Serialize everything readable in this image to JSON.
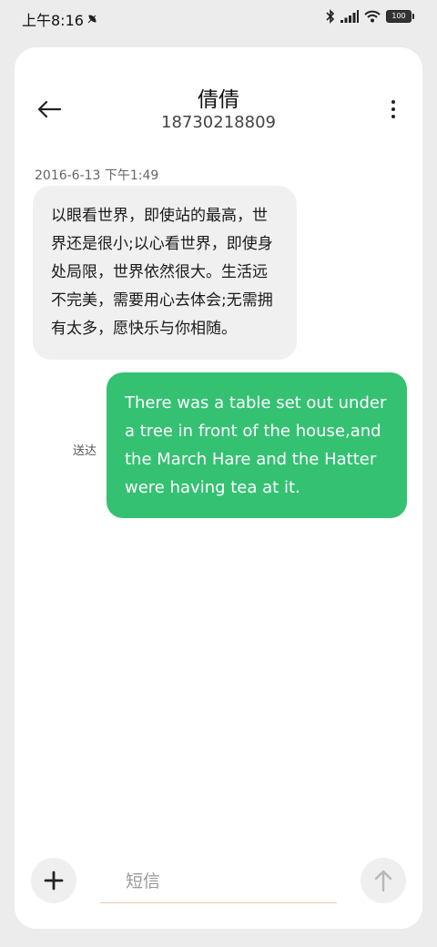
{
  "status_bar": {
    "time": "上午8:16",
    "battery": "100"
  },
  "header": {
    "title": "倩倩",
    "subtitle": "18730218809"
  },
  "messages": [
    {
      "timestamp": "2016-6-13 下午1:49",
      "direction": "incoming",
      "text": "以眼看世界，即使站的最高，世界还是很小;以心看世界，即使身处局限，世界依然很大。生活远不完美，需要用心去体会;无需拥有太多，愿快乐与你相随。"
    },
    {
      "direction": "outgoing",
      "status": "送达",
      "text": "There was a table set out under a tree in front of the house,and the March Hare and the Hatter were having tea at it."
    }
  ],
  "compose": {
    "placeholder": "短信"
  },
  "colors": {
    "outgoing_bubble": "#34c172",
    "incoming_bubble": "#f0f0f0",
    "background": "#ececec",
    "card": "#ffffff"
  }
}
